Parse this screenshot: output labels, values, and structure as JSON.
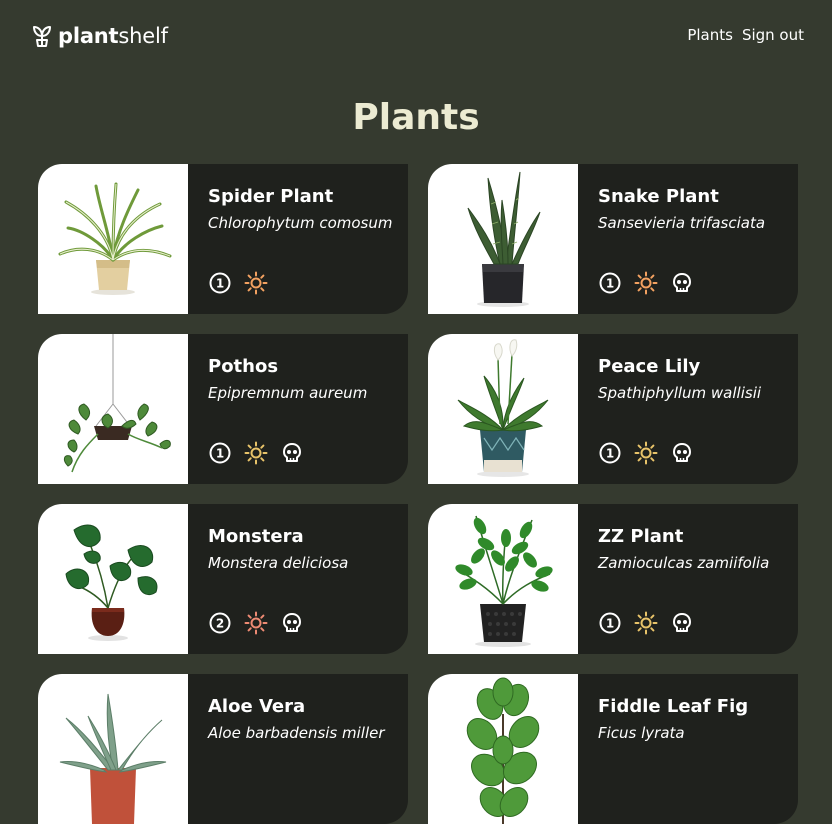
{
  "app": {
    "logo_bold": "plant",
    "logo_light": "shelf",
    "nav": [
      "Plants",
      "Sign out"
    ]
  },
  "page": {
    "title": "Plants"
  },
  "colors": {
    "background": "#353a2f",
    "card": "#1f211d",
    "title": "#ecebd2",
    "sun_medium": "#e9c46a",
    "sun_high": "#f4a261",
    "sun_very_high": "#ef8b74"
  },
  "plants": [
    {
      "name": "Spider Plant",
      "scientific": "Chlorophytum comosum",
      "water_level": "1",
      "sun": "high",
      "toxic": false,
      "image": "spider-plant"
    },
    {
      "name": "Snake Plant",
      "scientific": "Sansevieria trifasciata",
      "water_level": "1",
      "sun": "high",
      "toxic": true,
      "image": "snake-plant"
    },
    {
      "name": "Pothos",
      "scientific": "Epipremnum aureum",
      "water_level": "1",
      "sun": "medium",
      "toxic": true,
      "image": "pothos"
    },
    {
      "name": "Peace Lily",
      "scientific": "Spathiphyllum wallisii",
      "water_level": "1",
      "sun": "medium",
      "toxic": true,
      "image": "peace-lily"
    },
    {
      "name": "Monstera",
      "scientific": "Monstera deliciosa",
      "water_level": "2",
      "sun": "very-high",
      "toxic": true,
      "image": "monstera"
    },
    {
      "name": "ZZ Plant",
      "scientific": "Zamioculcas zamiifolia",
      "water_level": "1",
      "sun": "medium",
      "toxic": true,
      "image": "zz-plant"
    },
    {
      "name": "Aloe Vera",
      "scientific": "Aloe barbadensis miller",
      "water_level": "",
      "sun": "",
      "toxic": false,
      "image": "aloe-vera"
    },
    {
      "name": "Fiddle Leaf Fig",
      "scientific": "Ficus lyrata",
      "water_level": "",
      "sun": "",
      "toxic": false,
      "image": "fiddle-leaf-fig"
    }
  ]
}
